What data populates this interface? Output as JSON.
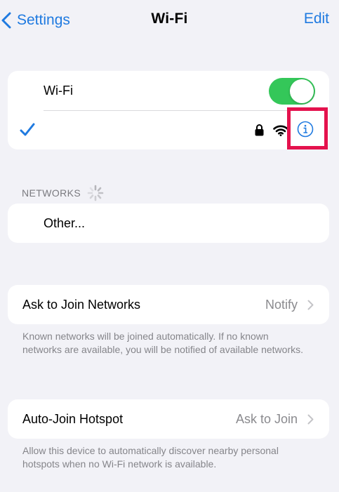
{
  "nav": {
    "back_label": "Settings",
    "title": "Wi-Fi",
    "edit_label": "Edit"
  },
  "wifi_card": {
    "toggle_label": "Wi-Fi",
    "toggle_on": true,
    "connected_network_name": ""
  },
  "networks": {
    "header": "NETWORKS",
    "other_label": "Other..."
  },
  "ask_to_join": {
    "label": "Ask to Join Networks",
    "value": "Notify",
    "footnote": "Known networks will be joined automatically. If no known networks are available, you will be notified of available networks."
  },
  "auto_join_hotspot": {
    "label": "Auto-Join Hotspot",
    "value": "Ask to Join",
    "footnote": "Allow this device to automatically discover nearby personal hotspots when no Wi-Fi network is available."
  },
  "colors": {
    "accent": "#1F7AE0",
    "toggle_on": "#34C759",
    "highlight": "#E4124D",
    "background": "#F2F2F7"
  },
  "icons": {
    "back": "chevron-left-icon",
    "checkmark": "checkmark-icon",
    "lock": "lock-icon",
    "wifi": "wifi-signal-icon",
    "info": "info-icon",
    "spinner": "loading-spinner-icon",
    "chevron": "chevron-right-icon"
  }
}
